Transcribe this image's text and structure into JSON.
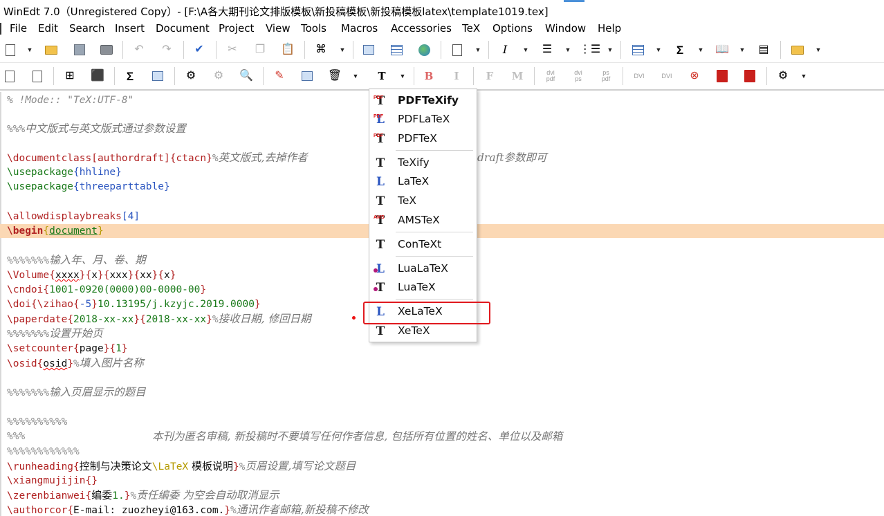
{
  "window": {
    "title": "WinEdt 7.0（Unregistered  Copy）- [F:\\A各大期刊论文排版模板\\新投稿模板\\新投稿模板latex\\template1019.tex]"
  },
  "menu": [
    "File",
    "Edit",
    "Search",
    "Insert",
    "Document",
    "Project",
    "View",
    "Tools",
    "Macros",
    "Accessories",
    "TeX",
    "Options",
    "Window",
    "Help"
  ],
  "toolbar2": {
    "bold": "B",
    "italic": "I",
    "f": "F",
    "m": "M",
    "dvipdf": "dvi pdf",
    "dvips": "dvi ps",
    "pspdf": "ps pdf",
    "dvi1": "DVI",
    "dvi2": "DVI"
  },
  "editor": {
    "lines": {
      "l1": "% !Mode:: \"TeX:UTF-8\"",
      "l2_pct": "%%%",
      "l2_text": "中文版式与英文版式通过参数设置",
      "l3_cmd": "\\documentclass",
      "l3_opt": "[authordraft]",
      "l3_arg": "{ctacn}",
      "l3_pct": "%",
      "l3_comment": "英文版式,去掉作者",
      "l3_tail": "draft参数即可",
      "l4_cmd": "\\usepackage",
      "l4_arg": "{hhline}",
      "l5_cmd": "\\usepackage",
      "l5_arg": "{threeparttable}",
      "l6_cmd": "\\allowdisplaybreaks",
      "l6_arg": "[4]",
      "l7_cmd": "\\begin",
      "l7_arg": "document",
      "l8_pct": "%%%%%%%",
      "l8_text": "输入年、月、卷、期",
      "l9_cmd": "\\Volume",
      "l9_a": "xxxx",
      "l9_b": "x",
      "l9_c": "xxx",
      "l9_d": "xx",
      "l9_e": "x",
      "l10_cmd": "\\cndoi",
      "l10_arg": "1001-0920(0000)00-0000-00",
      "l11_cmd": "\\doi",
      "l11_inner": "\\zihao",
      "l11_num": "-5",
      "l11_rest": "10.13195/j.kzyjc.2019.0000",
      "l12_cmd": "\\paperdate",
      "l12_a": "2018-xx-xx",
      "l12_b": "2018-xx-xx",
      "l12_pct": "%",
      "l12_comment": "接收日期, 修回日期",
      "l13_pct": "%%%%%%%",
      "l13_text": "设置开始页",
      "l14_cmd": "\\setcounter",
      "l14_a": "page",
      "l14_b": "1",
      "l15_cmd": "\\osid",
      "l15_arg": "osid",
      "l15_pct": "%",
      "l15_comment": "填入图片名称",
      "l16_pct": "%%%%%%%",
      "l16_text": "输入页眉显示的题目",
      "l17_pct": "%%%%%%%%%%",
      "l18_pct": "%%%",
      "l18_text": "本刊为匿名审稿, 新投稿时不要填写任何作者信息, 包括所有位置的姓名、单位以及邮箱",
      "l19_pct": "%%%%%%%%%%%%",
      "l20_cmd": "\\runheading",
      "l20_cn1": "控制与决策论文",
      "l20_latex": "\\LaTeX",
      "l20_cn2": " 模板说明",
      "l20_pct": "%",
      "l20_comment": "页眉设置,填写论文题目",
      "l21_cmd": "\\xiangmujijin",
      "l21_arg": "{}",
      "l22_cmd": "\\zerenbianwei",
      "l22_cn": "编委",
      "l22_num": "1.",
      "l22_pct": "%",
      "l22_comment": "责任编委 为空会自动取消显示",
      "l23_cmd": "\\authorcor",
      "l23_arg": "E-mail: zuozheyi@163.com.",
      "l23_pct": "%",
      "l23_comment": "通讯作者邮箱,新投稿不修改"
    }
  },
  "dropdown": {
    "items": [
      "PDFTeXify",
      "PDFLaTeX",
      "PDFTeX",
      "TeXify",
      "LaTeX",
      "TeX",
      "AMSTeX",
      "ConTeXt",
      "LuaLaTeX",
      "LuaTeX",
      "XeLaTeX",
      "XeTeX"
    ],
    "selected": "PDFTeXify",
    "highlighted": "XeLaTeX",
    "icon_pdf_tag": "PDF",
    "icon_ams_tag": "AMS"
  },
  "colors": {
    "current_line": "#fbd8b4",
    "command": "#b12222",
    "argument": "#1a7a1a",
    "number": "#2a55c0",
    "comment": "#8a8a8a",
    "highlight_box": "#e0191e"
  }
}
